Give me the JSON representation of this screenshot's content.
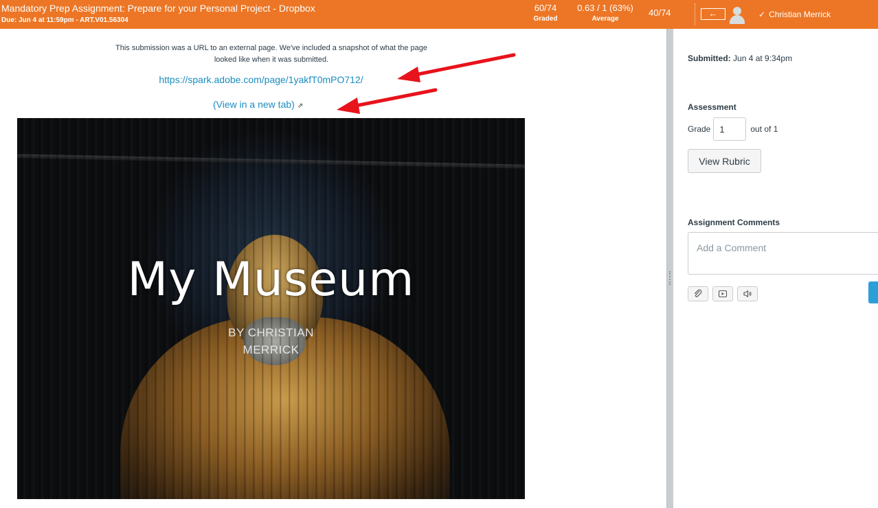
{
  "header": {
    "assignment_title": "Mandatory Prep Assignment: Prepare for your Personal Project - Dropbox",
    "due_line": "Due: Jun 4 at 11:59pm - ART.V01.56304",
    "graded_count": "60/74",
    "graded_label": "Graded",
    "average_value": "0.63 / 1 (63%)",
    "average_label": "Average",
    "student_position": "40/74",
    "back_arrow": "←",
    "student_name": "Christian Merrick",
    "check": "✓",
    "brand_color": "#ec7625"
  },
  "submission": {
    "notice": "This submission was a URL to an external page. We've included a snapshot of what the page looked like when it was submitted.",
    "url": "https://spark.adobe.com/page/1yakfT0mPO712/",
    "new_tab_label": "(View in a new tab)",
    "external_icon": "external-link-icon",
    "snapshot": {
      "title": "My Museum",
      "byline_1": "BY CHRISTIAN",
      "byline_2": "MERRICK"
    }
  },
  "sidebar": {
    "submitted_label": "Submitted:",
    "submitted_value": "Jun 4 at 9:34pm",
    "assessment_heading": "Assessment",
    "grade_label": "Grade",
    "grade_value": "1",
    "out_of": "out of 1",
    "view_rubric": "View Rubric",
    "comments_heading": "Assignment Comments",
    "comment_placeholder": "Add a Comment",
    "tools": [
      "paperclip-icon",
      "media-icon",
      "audio-icon"
    ],
    "accent_color": "#2d9fd8"
  },
  "annotations": {
    "arrow_color": "#e8131b"
  }
}
